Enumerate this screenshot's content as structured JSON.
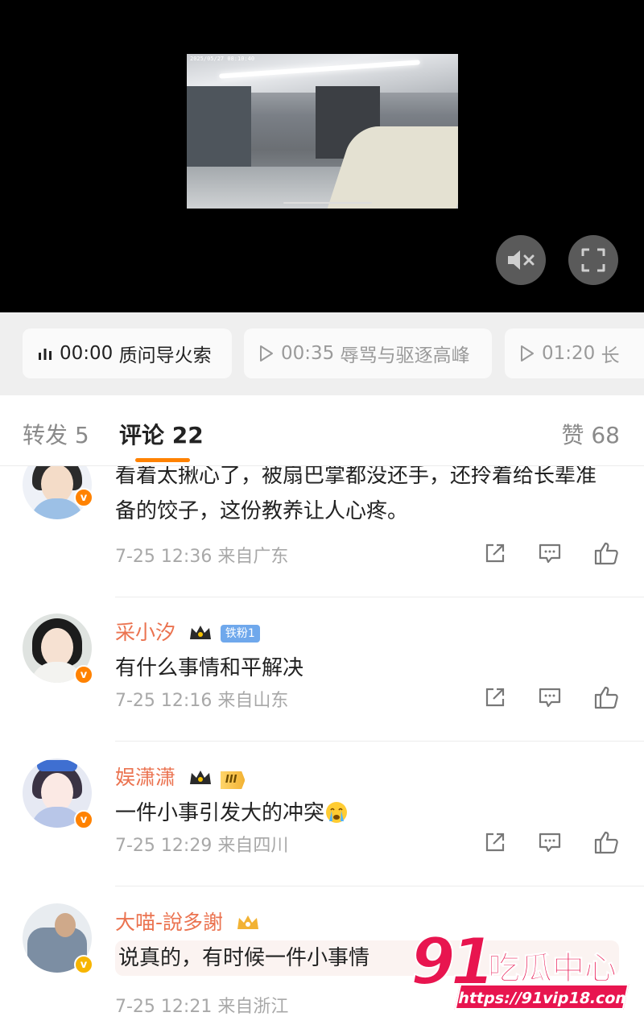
{
  "video": {
    "timestamp_overlay": "2025/05/27 08:10:40",
    "mute_icon": "speaker-mute-icon",
    "fullscreen_icon": "fullscreen-icon"
  },
  "chapters": [
    {
      "time": "00:00",
      "title": "质问导火索",
      "active": true,
      "icon": "audio-bars-icon"
    },
    {
      "time": "00:35",
      "title": "辱骂与驱逐高峰",
      "active": false,
      "icon": "play-icon"
    },
    {
      "time": "01:20",
      "title": "长",
      "active": false,
      "icon": "play-icon"
    }
  ],
  "tabs": {
    "repost": "转发 5",
    "comments": "评论 22",
    "likes": "赞 68",
    "accent_color": "#ff8200"
  },
  "comments": [
    {
      "name": "",
      "text": "看着太揪心了，被扇巴掌都没还手，还拎着给长辈准备的饺子，这份教养让人心疼。",
      "meta": "7-25 12:36 来自广东",
      "badge": ""
    },
    {
      "name": "采小汐",
      "fan_badge": "铁粉1",
      "text": "有什么事情和平解决",
      "meta": "7-25 12:16 来自山东"
    },
    {
      "name": "娱潇潇",
      "level_badge": "III",
      "text": "一件小事引发大的冲突",
      "emoji": "crying-face-icon",
      "meta": "7-25 12:29 来自四川"
    },
    {
      "name": "大喵-說多謝",
      "text": "说真的，有时候一件小事情",
      "meta": "7-25 12:21 来自浙江"
    }
  ],
  "watermark": {
    "number": "91",
    "text": "吃瓜中心",
    "url": "https://91vip18.com"
  }
}
